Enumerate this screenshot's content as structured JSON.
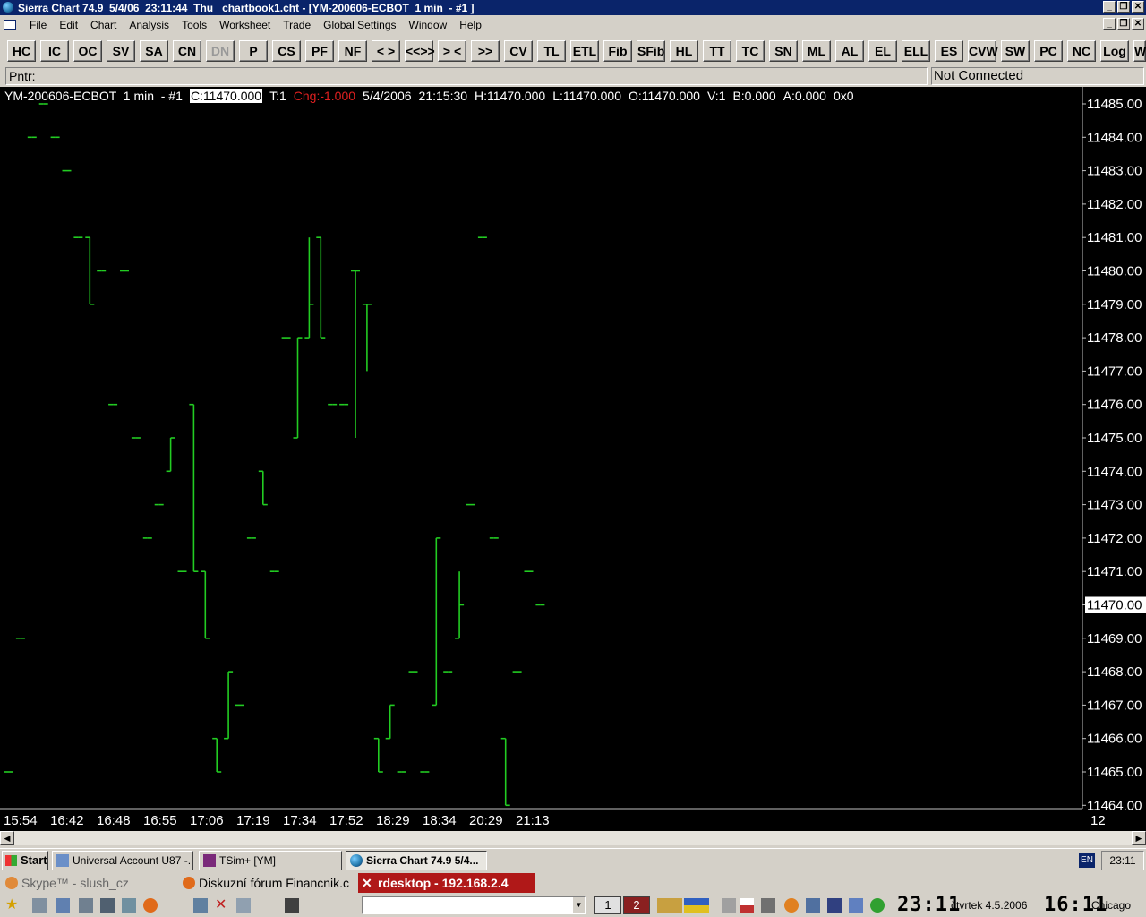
{
  "window": {
    "title": "Sierra Chart 74.9  5/4/06  23:11:44  Thu   chartbook1.cht - [YM-200606-ECBOT  1 min  - #1 ]",
    "btn_min": "_",
    "btn_restore": "❐",
    "btn_close": "✕"
  },
  "menu": [
    "File",
    "Edit",
    "Chart",
    "Analysis",
    "Tools",
    "Worksheet",
    "Trade",
    "Global Settings",
    "Window",
    "Help"
  ],
  "toolbar": [
    {
      "label": "HC"
    },
    {
      "label": "IC"
    },
    {
      "label": "OC"
    },
    {
      "label": "SV"
    },
    {
      "label": "SA"
    },
    {
      "label": "CN"
    },
    {
      "label": "DN",
      "disabled": true
    },
    {
      "label": "P"
    },
    {
      "label": "CS"
    },
    {
      "label": "PF"
    },
    {
      "label": "NF"
    },
    {
      "label": "< >"
    },
    {
      "label": "<<>>"
    },
    {
      "label": "> <"
    },
    {
      "label": ">><<"
    },
    {
      "label": "CV"
    },
    {
      "label": "TL"
    },
    {
      "label": "ETL"
    },
    {
      "label": "Fib"
    },
    {
      "label": "SFib"
    },
    {
      "label": "HL"
    },
    {
      "label": "TT"
    },
    {
      "label": "TC"
    },
    {
      "label": "SN"
    },
    {
      "label": "ML"
    },
    {
      "label": "AL"
    },
    {
      "label": "EL"
    },
    {
      "label": "ELL"
    },
    {
      "label": "ES"
    },
    {
      "label": "CVW"
    },
    {
      "label": "SW"
    },
    {
      "label": "PC"
    },
    {
      "label": "NC"
    },
    {
      "label": "Log"
    },
    {
      "label": "W"
    }
  ],
  "pointer_label": "Pntr:",
  "connection_status": "Not Connected",
  "info": {
    "symbol": "YM-200606-ECBOT  1 min  - #1",
    "close": "C:11470.000",
    "ticks": "T:1",
    "change": "Chg:-1.000",
    "date": "5/4/2006",
    "time": "21:15:30",
    "high": "H:11470.000",
    "low": "L:11470.000",
    "open": "O:11470.000",
    "volume": "V:1",
    "bid": "B:0.000",
    "ask": "A:0.000",
    "extra": "0x0"
  },
  "chart_data": {
    "type": "ohlc",
    "price_labels": [
      "11485.00",
      "11484.00",
      "11483.00",
      "11482.00",
      "11481.00",
      "11480.00",
      "11479.00",
      "11478.00",
      "11477.00",
      "11476.00",
      "11475.00",
      "11474.00",
      "11473.00",
      "11472.00",
      "11471.00",
      "11470.00",
      "11469.00",
      "11468.00",
      "11467.00",
      "11466.00",
      "11465.00",
      "11464.00"
    ],
    "current_price_label": "11470.00",
    "time_labels": [
      "15:54",
      "16:42",
      "16:48",
      "16:55",
      "17:06",
      "17:19",
      "17:34",
      "17:52",
      "18:29",
      "18:34",
      "20:29",
      "21:13"
    ],
    "right_axis_time_label": "12",
    "ylim": [
      11464,
      11485
    ],
    "bars": [
      {
        "o": 11465,
        "h": 11465,
        "l": 11465,
        "c": 11465
      },
      {
        "o": 11469,
        "h": 11469,
        "l": 11469,
        "c": 11469
      },
      {
        "o": 11484,
        "h": 11484,
        "l": 11484,
        "c": 11484
      },
      {
        "o": 11485,
        "h": 11485,
        "l": 11485,
        "c": 11485
      },
      {
        "o": 11484,
        "h": 11484,
        "l": 11484,
        "c": 11484
      },
      {
        "o": 11483,
        "h": 11483,
        "l": 11483,
        "c": 11483
      },
      {
        "o": 11481,
        "h": 11481,
        "l": 11481,
        "c": 11481
      },
      {
        "o": 11481,
        "h": 11481,
        "l": 11479,
        "c": 11479
      },
      {
        "o": 11480,
        "h": 11480,
        "l": 11480,
        "c": 11480
      },
      {
        "o": 11476,
        "h": 11476,
        "l": 11476,
        "c": 11476
      },
      {
        "o": 11480,
        "h": 11480,
        "l": 11480,
        "c": 11480
      },
      {
        "o": 11475,
        "h": 11475,
        "l": 11475,
        "c": 11475
      },
      {
        "o": 11472,
        "h": 11472,
        "l": 11472,
        "c": 11472
      },
      {
        "o": 11473,
        "h": 11473,
        "l": 11473,
        "c": 11473
      },
      {
        "o": 11474,
        "h": 11475,
        "l": 11474,
        "c": 11475
      },
      {
        "o": 11471,
        "h": 11471,
        "l": 11471,
        "c": 11471
      },
      {
        "o": 11476,
        "h": 11476,
        "l": 11471,
        "c": 11471
      },
      {
        "o": 11471,
        "h": 11471,
        "l": 11469,
        "c": 11469
      },
      {
        "o": 11466,
        "h": 11466,
        "l": 11465,
        "c": 11465
      },
      {
        "o": 11466,
        "h": 11468,
        "l": 11466,
        "c": 11468
      },
      {
        "o": 11467,
        "h": 11467,
        "l": 11467,
        "c": 11467
      },
      {
        "o": 11472,
        "h": 11472,
        "l": 11472,
        "c": 11472
      },
      {
        "o": 11474,
        "h": 11474,
        "l": 11473,
        "c": 11473
      },
      {
        "o": 11471,
        "h": 11471,
        "l": 11471,
        "c": 11471
      },
      {
        "o": 11478,
        "h": 11478,
        "l": 11478,
        "c": 11478
      },
      {
        "o": 11475,
        "h": 11478,
        "l": 11475,
        "c": 11478
      },
      {
        "o": 11478,
        "h": 11481,
        "l": 11478,
        "c": 11479
      },
      {
        "o": 11481,
        "h": 11481,
        "l": 11478,
        "c": 11478
      },
      {
        "o": 11476,
        "h": 11476,
        "l": 11476,
        "c": 11476
      },
      {
        "o": 11476,
        "h": 11476,
        "l": 11476,
        "c": 11476
      },
      {
        "o": 11480,
        "h": 11480,
        "l": 11475,
        "c": 11480
      },
      {
        "o": 11479,
        "h": 11479,
        "l": 11477,
        "c": 11479
      },
      {
        "o": 11466,
        "h": 11466,
        "l": 11465,
        "c": 11465
      },
      {
        "o": 11466,
        "h": 11467,
        "l": 11466,
        "c": 11467
      },
      {
        "o": 11465,
        "h": 11465,
        "l": 11465,
        "c": 11465
      },
      {
        "o": 11468,
        "h": 11468,
        "l": 11468,
        "c": 11468
      },
      {
        "o": 11465,
        "h": 11465,
        "l": 11465,
        "c": 11465
      },
      {
        "o": 11467,
        "h": 11472,
        "l": 11467,
        "c": 11472
      },
      {
        "o": 11468,
        "h": 11468,
        "l": 11468,
        "c": 11468
      },
      {
        "o": 11469,
        "h": 11471,
        "l": 11469,
        "c": 11470
      },
      {
        "o": 11473,
        "h": 11473,
        "l": 11473,
        "c": 11473
      },
      {
        "o": 11481,
        "h": 11481,
        "l": 11481,
        "c": 11481
      },
      {
        "o": 11472,
        "h": 11472,
        "l": 11472,
        "c": 11472
      },
      {
        "o": 11466,
        "h": 11466,
        "l": 11464,
        "c": 11464
      },
      {
        "o": 11468,
        "h": 11468,
        "l": 11468,
        "c": 11468
      },
      {
        "o": 11471,
        "h": 11471,
        "l": 11471,
        "c": 11471
      },
      {
        "o": 11470,
        "h": 11470,
        "l": 11470,
        "c": 11470
      }
    ],
    "bar_color": "#22cc22"
  },
  "taskbar": {
    "start": "Start",
    "tasks": [
      {
        "label": "Universal Account U87  -...",
        "active": false
      },
      {
        "label": "TSim+  [YM]",
        "active": false
      },
      {
        "label": "Sierra Chart 74.9  5/4...",
        "active": true
      }
    ],
    "lang": "EN",
    "clock": "23:11"
  },
  "rdesktop_bar": {
    "tasks": [
      {
        "label": "Skype™ - slush_cz",
        "active": false
      },
      {
        "label": "Diskuzní fórum Financnik.c",
        "active": false
      },
      {
        "label": "rdesktop - 192.168.2.4",
        "active": true
      }
    ]
  },
  "bottom_panel": {
    "workspaces": [
      "1",
      "2"
    ],
    "big_clock_left": "23:11",
    "date": "čtvrtek  4.5.2006",
    "big_clock_right": "16:11",
    "city": "Chicago"
  },
  "colors": {
    "title_bg": "#0a246a",
    "chart_bg": "#000000",
    "bar_green": "#22cc22",
    "change_red": "#e02020",
    "rdesktop_active": "#b01818"
  }
}
